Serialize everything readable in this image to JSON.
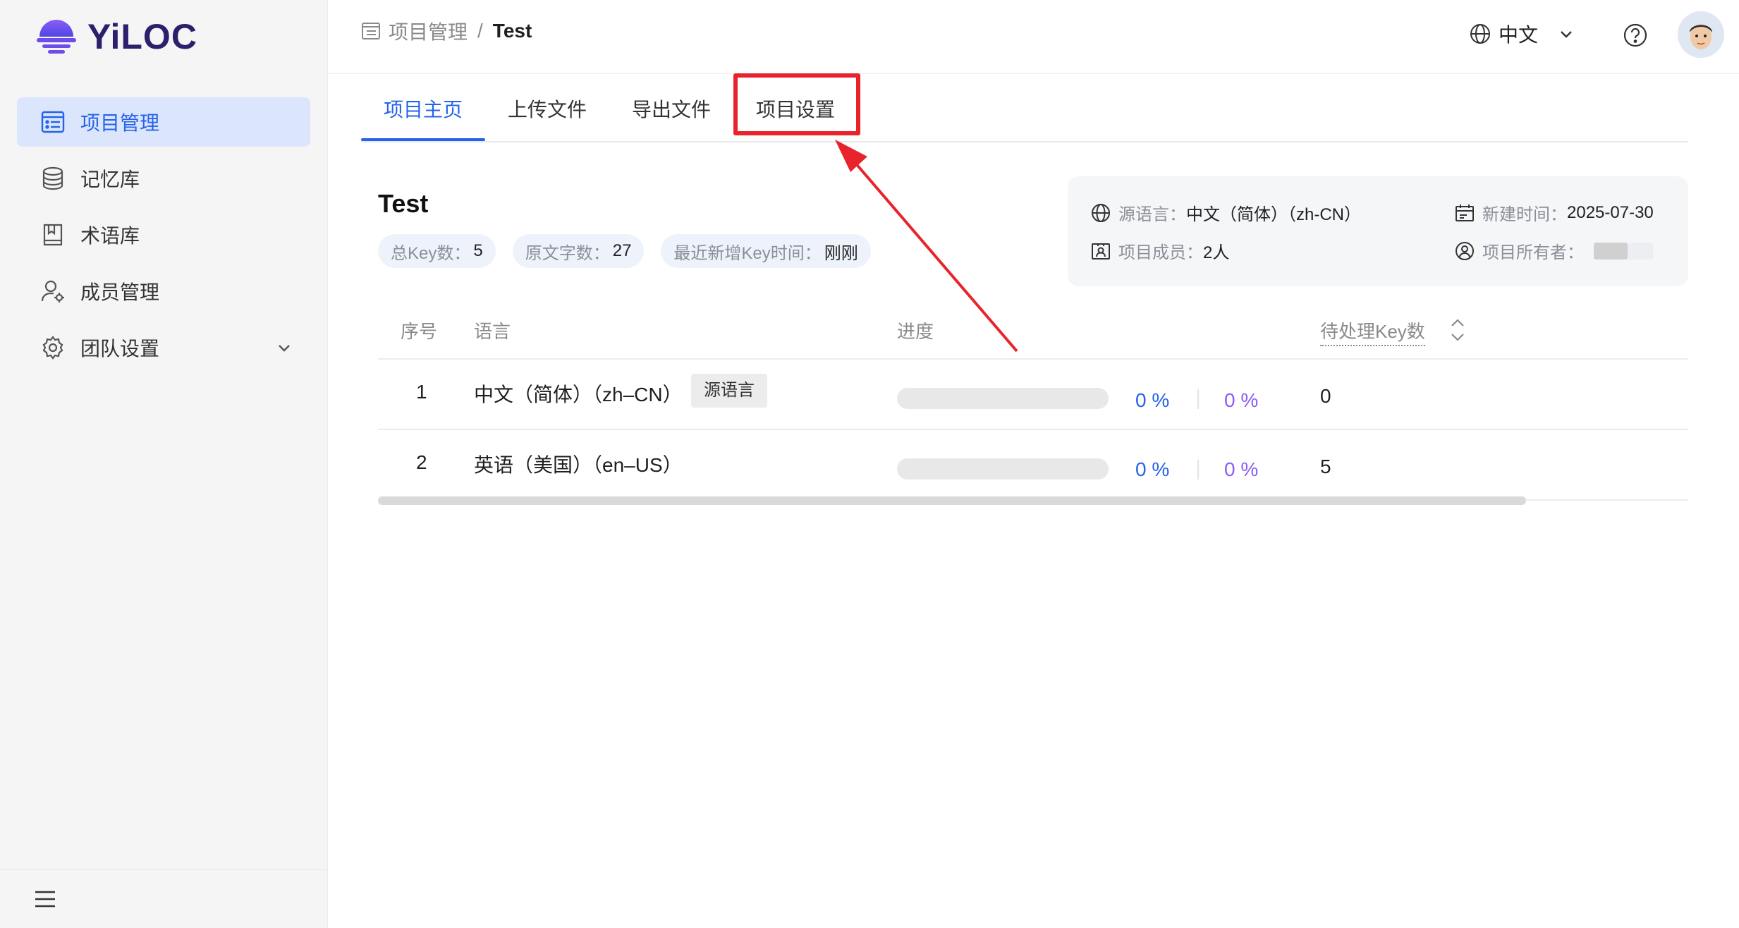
{
  "app": {
    "logo_text": "YiLOC"
  },
  "sidebar": {
    "items": [
      {
        "label": "项目管理",
        "icon": "project-list-icon",
        "active": true
      },
      {
        "label": "记忆库",
        "icon": "database-icon"
      },
      {
        "label": "术语库",
        "icon": "book-icon"
      },
      {
        "label": "成员管理",
        "icon": "user-settings-icon"
      },
      {
        "label": "团队设置",
        "icon": "gear-icon",
        "expandable": true
      }
    ]
  },
  "header": {
    "breadcrumb_parent": "项目管理",
    "breadcrumb_separator": "/",
    "breadcrumb_current": "Test",
    "language": "中文"
  },
  "tabs": [
    "项目主页",
    "上传文件",
    "导出文件",
    "项目设置"
  ],
  "project": {
    "title": "Test",
    "stats": [
      {
        "label": "总Key数：",
        "value": "5"
      },
      {
        "label": "原文字数：",
        "value": "27"
      },
      {
        "label": "最近新增Key时间：",
        "value": "刚刚"
      }
    ],
    "info": {
      "source_lang_label": "源语言：",
      "source_lang_value": "中文（简体）（zh-CN）",
      "members_label": "项目成员：",
      "members_value": "2人",
      "created_label": "新建时间：",
      "created_value": "2025-07-30",
      "owner_label": "项目所有者："
    }
  },
  "table": {
    "columns": [
      "序号",
      "语言",
      "进度",
      "待处理Key数"
    ],
    "rows": [
      {
        "index": "1",
        "language": "中文（简体）（zh–CN）",
        "tag": "源语言",
        "progress_a": "0 %",
        "progress_b": "0 %",
        "pending": "0",
        "fill": 0
      },
      {
        "index": "2",
        "language": "英语（美国）（en–US）",
        "tag": "",
        "progress_a": "0 %",
        "progress_b": "0 %",
        "pending": "5",
        "fill": 0
      }
    ]
  },
  "colors": {
    "accent": "#2563eb",
    "highlight": "#e8232b",
    "purple": "#8b5cf6"
  }
}
